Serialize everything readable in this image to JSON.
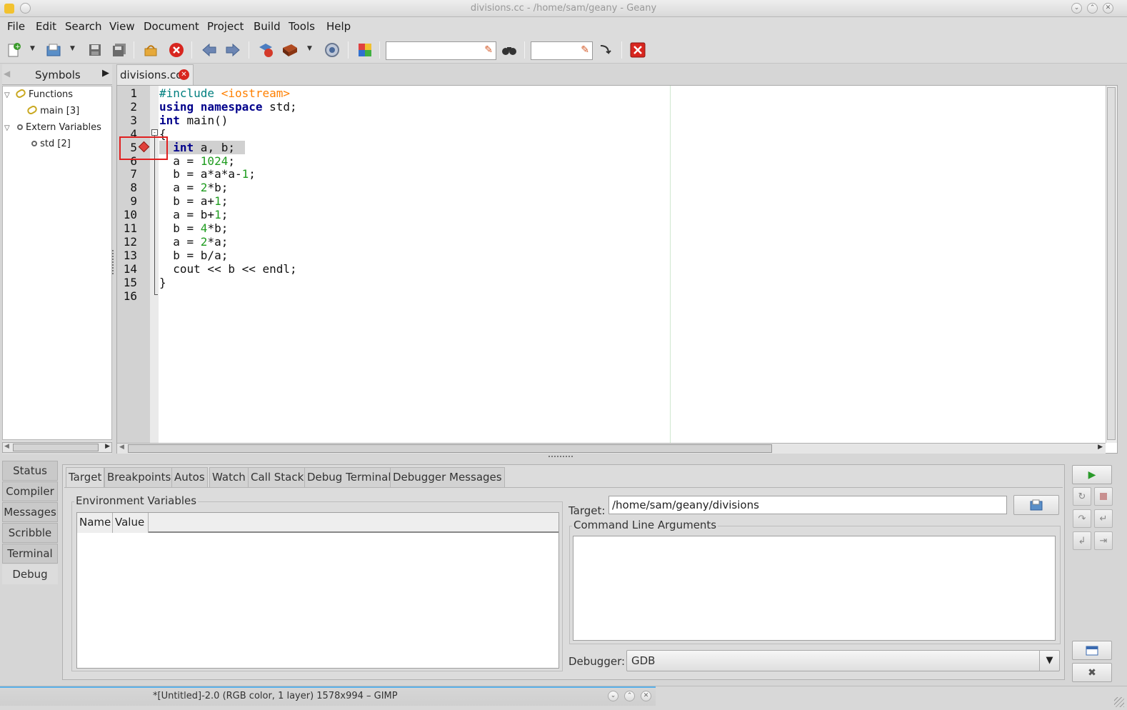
{
  "window": {
    "title": "divisions.cc - /home/sam/geany - Geany"
  },
  "menu": [
    "File",
    "Edit",
    "Search",
    "View",
    "Document",
    "Project",
    "Build",
    "Tools",
    "Help"
  ],
  "toolbar": {
    "icons": [
      "new-file-icon",
      "open-file-icon",
      "save-icon",
      "save-all-icon",
      "revert-icon",
      "close-icon",
      "back-icon",
      "forward-icon",
      "compile-icon",
      "build-icon",
      "run-icon",
      "color-chooser-icon",
      "find-icon",
      "goto-line-icon",
      "quit-icon"
    ],
    "search_value": "",
    "goto_value": ""
  },
  "sidebar": {
    "tab_label": "Symbols",
    "tree": [
      {
        "label": "Functions",
        "level": 0,
        "icon": "function-icon"
      },
      {
        "label": "main [3]",
        "level": 1,
        "icon": "function-icon"
      },
      {
        "label": "Extern Variables",
        "level": 0,
        "icon": "variable-icon"
      },
      {
        "label": "std [2]",
        "level": 1,
        "icon": "variable-icon"
      }
    ]
  },
  "editor": {
    "tab_label": "divisions.cc",
    "line_numbers": [
      "1",
      "2",
      "3",
      "4",
      "5",
      "6",
      "7",
      "8",
      "9",
      "10",
      "11",
      "12",
      "13",
      "14",
      "15",
      "16"
    ],
    "breakpoint_line": 5,
    "highlight_color": "#d0d0d0",
    "breakpoint_color": "#e0403a"
  },
  "message_tabs": [
    "Status",
    "Compiler",
    "Messages",
    "Scribble",
    "Terminal",
    "Debug"
  ],
  "active_message_tab": "Debug",
  "debug": {
    "tabs": [
      "Target",
      "Breakpoints",
      "Autos",
      "Watch",
      "Call Stack",
      "Debug Terminal",
      "Debugger Messages"
    ],
    "active_tab": "Target",
    "env_label": "Environment Variables",
    "env_columns": [
      "Name",
      "Value"
    ],
    "target_label": "Target:",
    "target_value": "/home/sam/geany/divisions",
    "args_label": "Command Line Arguments",
    "debugger_label": "Debugger:",
    "debugger_value": "GDB"
  },
  "taskbar": {
    "gimp_title": "*[Untitled]-2.0 (RGB color, 1 layer) 1578x994 – GIMP"
  }
}
